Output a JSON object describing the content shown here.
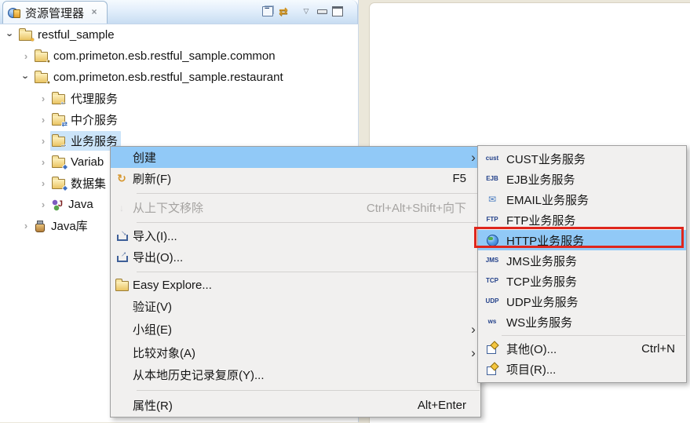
{
  "window": {
    "tab_title": "资源管理器"
  },
  "toolbar": {
    "icons": [
      "collapse-all",
      "link-with-editor",
      "view-menu",
      "minimize",
      "maximize"
    ]
  },
  "tree": {
    "items": [
      {
        "label": "restful_sample",
        "level": 1,
        "state": "expanded",
        "icon": "project-folder"
      },
      {
        "label": "com.primeton.esb.restful_sample.common",
        "level": 2,
        "state": "collapsed",
        "icon": "package"
      },
      {
        "label": "com.primeton.esb.restful_sample.restaurant",
        "level": 2,
        "state": "expanded",
        "icon": "package"
      },
      {
        "label": "代理服务",
        "level": 3,
        "state": "collapsed",
        "icon": "proxy-service-folder"
      },
      {
        "label": "中介服务",
        "level": 3,
        "state": "collapsed",
        "icon": "mediation-service-folder"
      },
      {
        "label": "业务服务",
        "level": 3,
        "state": "collapsed",
        "icon": "business-service-folder",
        "selected": true
      },
      {
        "label": "Variab",
        "level": 3,
        "state": "collapsed",
        "icon": "variables-folder"
      },
      {
        "label": "数据集",
        "level": 3,
        "state": "collapsed",
        "icon": "variables-folder"
      },
      {
        "label": "Java",
        "level": 3,
        "state": "collapsed",
        "icon": "java"
      },
      {
        "label": "Java库",
        "level": 2,
        "state": "collapsed",
        "icon": "java-library"
      }
    ]
  },
  "context_menu": {
    "items": [
      {
        "label": "创建",
        "submenu": true,
        "highlighted": true
      },
      {
        "label": "刷新(F)",
        "shortcut": "F5",
        "icon": "refresh"
      },
      {
        "separator": true
      },
      {
        "label": "从上下文移除",
        "shortcut": "Ctrl+Alt+Shift+向下",
        "icon": "remove-from-context",
        "disabled": true
      },
      {
        "separator": true
      },
      {
        "label": "导入(I)...",
        "icon": "import"
      },
      {
        "label": "导出(O)...",
        "icon": "export"
      },
      {
        "separator": true
      },
      {
        "label": "Easy Explore...",
        "icon": "folder"
      },
      {
        "label": "验证(V)"
      },
      {
        "label": "小组(E)",
        "submenu": true
      },
      {
        "label": "比较对象(A)",
        "submenu": true
      },
      {
        "label": "从本地历史记录复原(Y)..."
      },
      {
        "separator": true
      },
      {
        "label": "属性(R)",
        "shortcut": "Alt+Enter"
      }
    ]
  },
  "create_submenu": {
    "items": [
      {
        "label": "CUST业务服务",
        "icon": "cust",
        "icon_text": "cust"
      },
      {
        "label": "EJB业务服务",
        "icon": "ejb",
        "icon_text": "EJB"
      },
      {
        "label": "EMAIL业务服务",
        "icon": "email"
      },
      {
        "label": "FTP业务服务",
        "icon": "ftp",
        "icon_text": "FTP"
      },
      {
        "label": "HTTP业务服务",
        "icon": "http-globe",
        "highlighted": true,
        "red_box": true
      },
      {
        "label": "JMS业务服务",
        "icon": "jms",
        "icon_text": "JMS"
      },
      {
        "label": "TCP业务服务",
        "icon": "tcp",
        "icon_text": "TCP"
      },
      {
        "label": "UDP业务服务",
        "icon": "udp",
        "icon_text": "UDP"
      },
      {
        "label": "WS业务服务",
        "icon": "ws",
        "icon_text": "ws"
      },
      {
        "separator": true
      },
      {
        "label": "其他(O)...",
        "shortcut": "Ctrl+N",
        "icon": "new-wizard"
      },
      {
        "label": "项目(R)...",
        "icon": "new-project"
      }
    ]
  },
  "colors": {
    "menu_highlight": "#91c9f7",
    "tree_selection": "#cbe4f9",
    "annotation_red": "#df261c"
  }
}
